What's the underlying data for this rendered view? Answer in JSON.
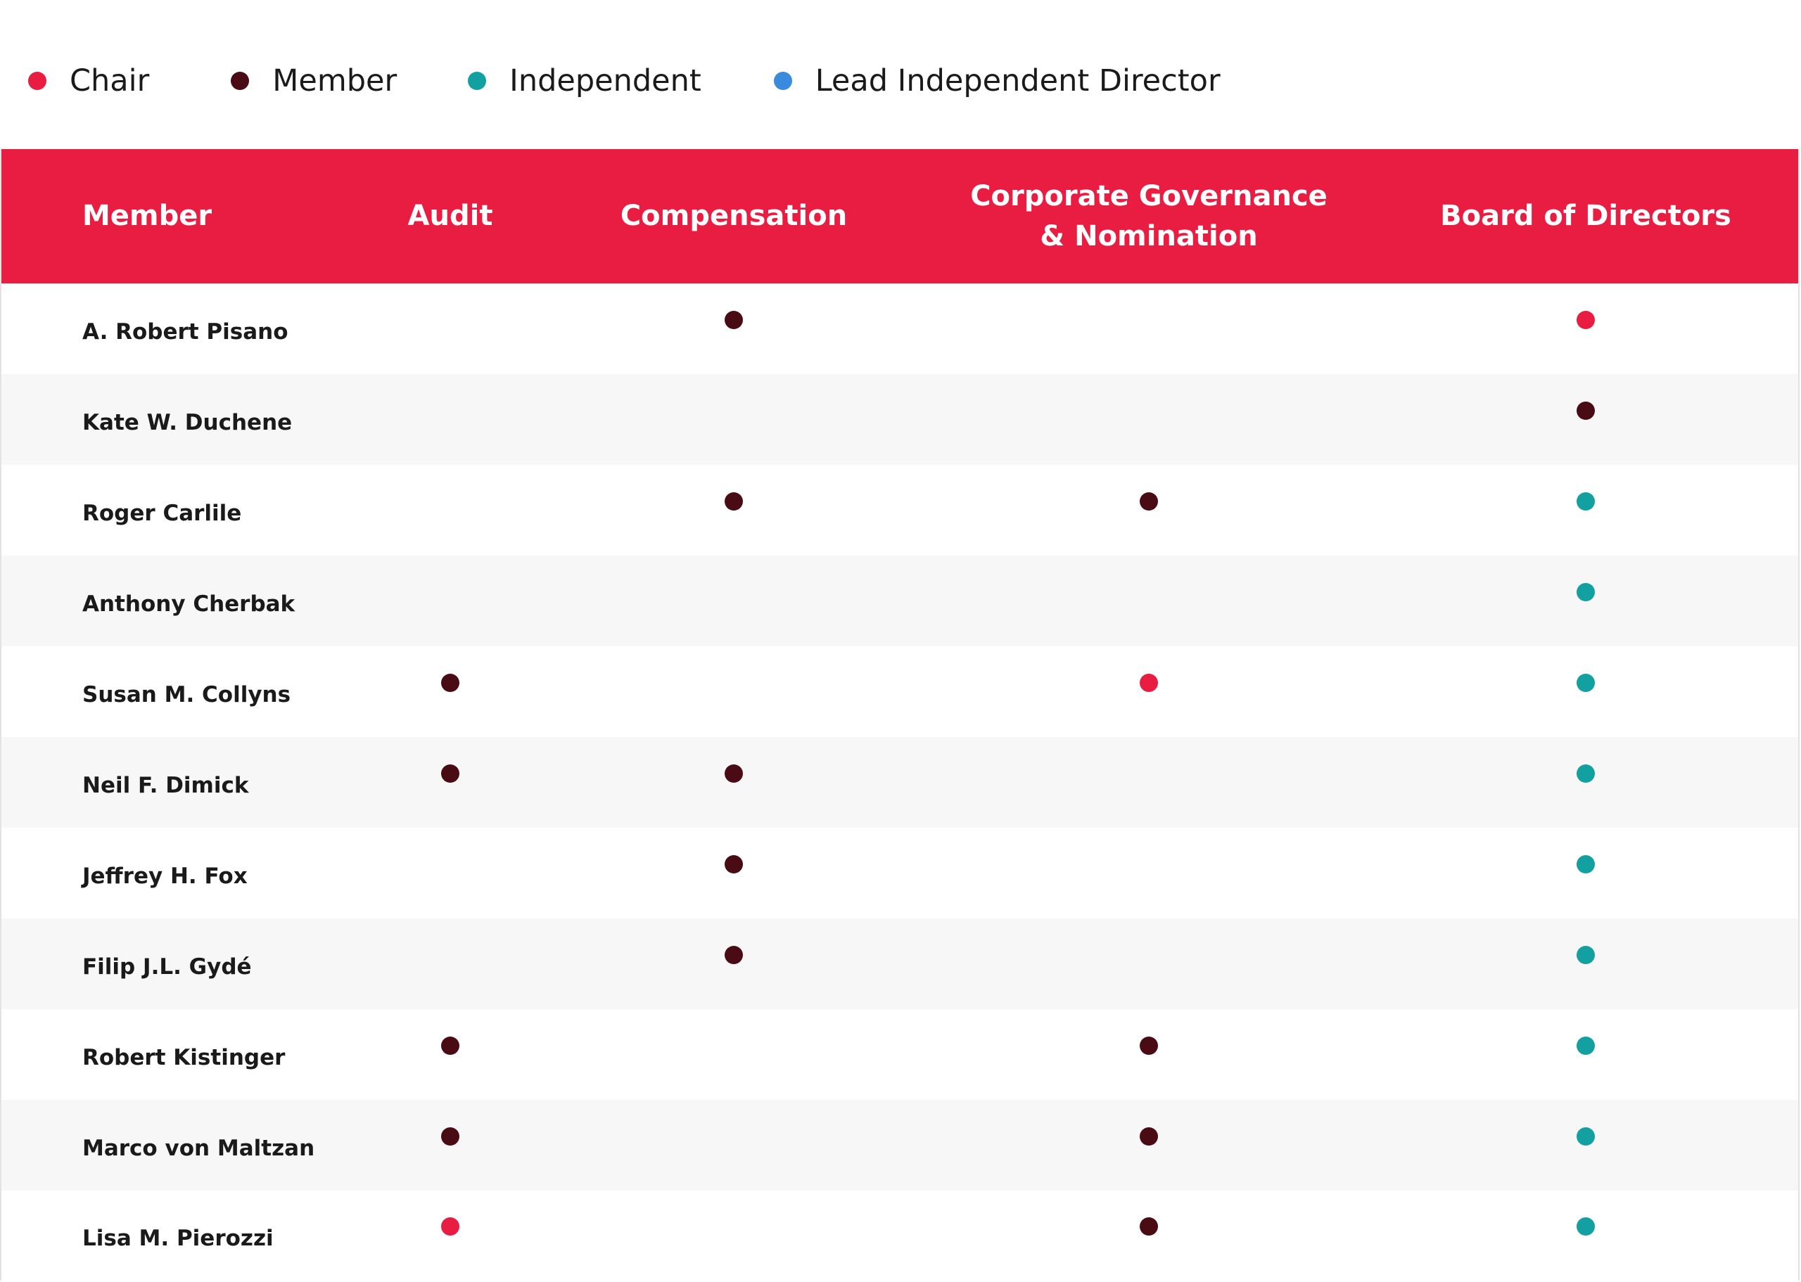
{
  "colors": {
    "chair": "#e91c41",
    "member": "#4a0c14",
    "independent": "#12a0a0",
    "lead_independent_director": "#3a8bde",
    "header_bg": "#e91c41",
    "row_alt_bg": "#f7f7f7"
  },
  "legend": [
    {
      "key": "chair",
      "label": "Chair"
    },
    {
      "key": "member",
      "label": "Member"
    },
    {
      "key": "independent",
      "label": "Independent"
    },
    {
      "key": "lead_independent_director",
      "label": "Lead Independent Director"
    }
  ],
  "table": {
    "headers": {
      "member": "Member",
      "audit": "Audit",
      "compensation": "Compensation",
      "governance_line1": "Corporate Governance",
      "governance_line2": "& Nomination",
      "board": "Board of Directors"
    },
    "rows": [
      {
        "name": "A. Robert Pisano",
        "audit": null,
        "compensation": "member",
        "governance": null,
        "board": "chair"
      },
      {
        "name": "Kate W. Duchene",
        "audit": null,
        "compensation": null,
        "governance": null,
        "board": "member"
      },
      {
        "name": "Roger Carlile",
        "audit": null,
        "compensation": "member",
        "governance": "member",
        "board": "independent"
      },
      {
        "name": "Anthony Cherbak",
        "audit": null,
        "compensation": null,
        "governance": null,
        "board": "independent"
      },
      {
        "name": "Susan M. Collyns",
        "audit": "member",
        "compensation": null,
        "governance": "chair",
        "board": "independent"
      },
      {
        "name": "Neil F. Dimick",
        "audit": "member",
        "compensation": "member",
        "governance": null,
        "board": "independent"
      },
      {
        "name": "Jeffrey H. Fox",
        "audit": null,
        "compensation": "member",
        "governance": null,
        "board": "independent"
      },
      {
        "name": "Filip J.L. Gydé",
        "audit": null,
        "compensation": "member",
        "governance": null,
        "board": "independent"
      },
      {
        "name": "Robert Kistinger",
        "audit": "member",
        "compensation": null,
        "governance": "member",
        "board": "independent"
      },
      {
        "name": "Marco von Maltzan",
        "audit": "member",
        "compensation": null,
        "governance": "member",
        "board": "independent"
      },
      {
        "name": "Lisa M. Pierozzi",
        "audit": "chair",
        "compensation": null,
        "governance": "member",
        "board": "independent"
      }
    ]
  }
}
